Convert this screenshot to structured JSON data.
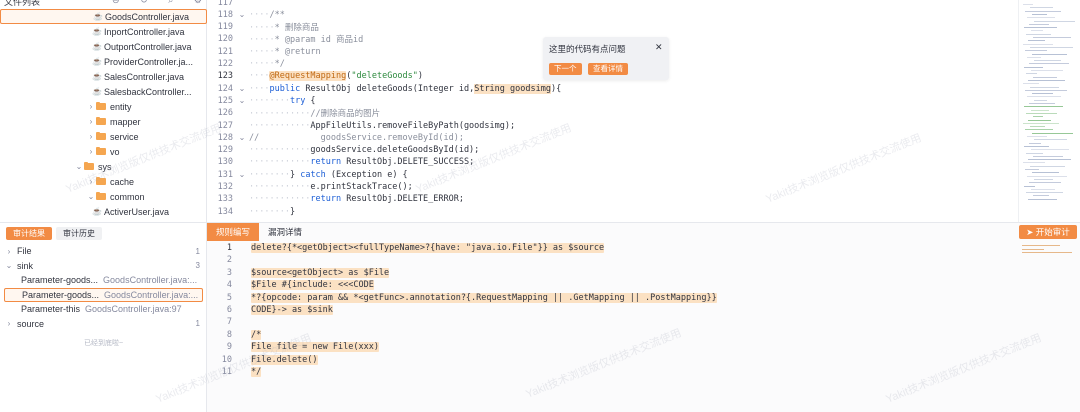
{
  "tree": {
    "title": "文件列表",
    "rows": [
      {
        "label": "GoodsController.java",
        "type": "java",
        "indent": 92,
        "selected": true
      },
      {
        "label": "InportController.java",
        "type": "java",
        "indent": 92
      },
      {
        "label": "OutportController.java",
        "type": "java",
        "indent": 92
      },
      {
        "label": "ProviderController.ja...",
        "type": "java",
        "indent": 92
      },
      {
        "label": "SalesController.java",
        "type": "java",
        "indent": 92
      },
      {
        "label": "SalesbackController...",
        "type": "java",
        "indent": 92
      },
      {
        "label": "entity",
        "type": "folder",
        "caret": "›",
        "indent": 86
      },
      {
        "label": "mapper",
        "type": "folder",
        "caret": "›",
        "indent": 86
      },
      {
        "label": "service",
        "type": "folder",
        "caret": "›",
        "indent": 86
      },
      {
        "label": "vo",
        "type": "folder",
        "caret": "›",
        "indent": 86
      },
      {
        "label": "sys",
        "type": "folder",
        "caret": "⌄",
        "indent": 74
      },
      {
        "label": "cache",
        "type": "folder",
        "caret": "›",
        "indent": 86
      },
      {
        "label": "common",
        "type": "folder",
        "caret": "⌄",
        "indent": 86
      },
      {
        "label": "ActiverUser.java",
        "type": "java",
        "indent": 92
      }
    ]
  },
  "audit": {
    "tabs": [
      "审计结果",
      "审计历史"
    ],
    "rows": [
      {
        "caret": "›",
        "label": "File",
        "count": "1"
      },
      {
        "caret": "⌄",
        "label": "sink",
        "count": "3"
      },
      {
        "caret": "",
        "label": "Parameter-goods...",
        "sub": "GoodsController.java:...",
        "indent": true
      },
      {
        "caret": "",
        "label": "Parameter-goods...",
        "sub": "GoodsController.java:...",
        "indent": true,
        "selected": true
      },
      {
        "caret": "",
        "label": "Parameter-this",
        "sub": "GoodsController.java:97",
        "indent": true
      },
      {
        "caret": "›",
        "label": "source",
        "count": "1"
      }
    ],
    "loaded_text": "已经到底啦~"
  },
  "editor": {
    "lines": [
      {
        "n": "117",
        "fold": "",
        "code": ""
      },
      {
        "n": "118",
        "fold": "⌄",
        "code": "    /**"
      },
      {
        "n": "119",
        "fold": "",
        "code": "     * 删除商品"
      },
      {
        "n": "120",
        "fold": "",
        "code": "     * @param id 商品id"
      },
      {
        "n": "121",
        "fold": "",
        "code": "     * @return"
      },
      {
        "n": "122",
        "fold": "",
        "code": "     */"
      },
      {
        "n": "123",
        "fold": "",
        "code": "    @RequestMapping(\"deleteGoods\")",
        "cur": true
      },
      {
        "n": "124",
        "fold": "⌄",
        "code": "    public ResultObj deleteGoods(Integer id,String goodsimg){"
      },
      {
        "n": "125",
        "fold": "⌄",
        "code": "        try {"
      },
      {
        "n": "126",
        "fold": "",
        "code": "            //删除商品的图片"
      },
      {
        "n": "127",
        "fold": "",
        "code": "            AppFileUtils.removeFileByPath(goodsimg);"
      },
      {
        "n": "128",
        "fold": "⌄",
        "code": "//            goodsService.removeById(id);"
      },
      {
        "n": "129",
        "fold": "",
        "code": "            goodsService.deleteGoodsById(id);"
      },
      {
        "n": "130",
        "fold": "",
        "code": "            return ResultObj.DELETE_SUCCESS;"
      },
      {
        "n": "131",
        "fold": "⌄",
        "code": "        } catch (Exception e) {"
      },
      {
        "n": "132",
        "fold": "",
        "code": "            e.printStackTrace();"
      },
      {
        "n": "133",
        "fold": "",
        "code": "            return ResultObj.DELETE_ERROR;"
      },
      {
        "n": "134",
        "fold": "",
        "code": "        }"
      }
    ]
  },
  "popup": {
    "message": "这里的代码有点问题",
    "close": "✕",
    "next": "下一个",
    "detail": "查看详情"
  },
  "rule": {
    "tabs": [
      "规则编写",
      "漏洞详情"
    ],
    "start": "开始审计",
    "lines": [
      {
        "n": "1",
        "code": "delete?{*<getObject><fullTypeName>?{have: \"java.io.File\"}} as $source",
        "cur": true
      },
      {
        "n": "2",
        "code": ""
      },
      {
        "n": "3",
        "code": "$source<getObject> as $File"
      },
      {
        "n": "4",
        "code": "$File #{include: <<<CODE"
      },
      {
        "n": "5",
        "code": "*?{opcode: param && *<getFunc>.annotation?{.RequestMapping || .GetMapping || .PostMapping}}"
      },
      {
        "n": "6",
        "code": "CODE}-> as $sink"
      },
      {
        "n": "7",
        "code": ""
      },
      {
        "n": "8",
        "code": "/*"
      },
      {
        "n": "9",
        "code": "File file = new File(xxx)"
      },
      {
        "n": "10",
        "code": "File.delete()"
      },
      {
        "n": "11",
        "code": "*/"
      }
    ]
  },
  "watermark": "Yakit技术浏览版仅供技术交流使用"
}
